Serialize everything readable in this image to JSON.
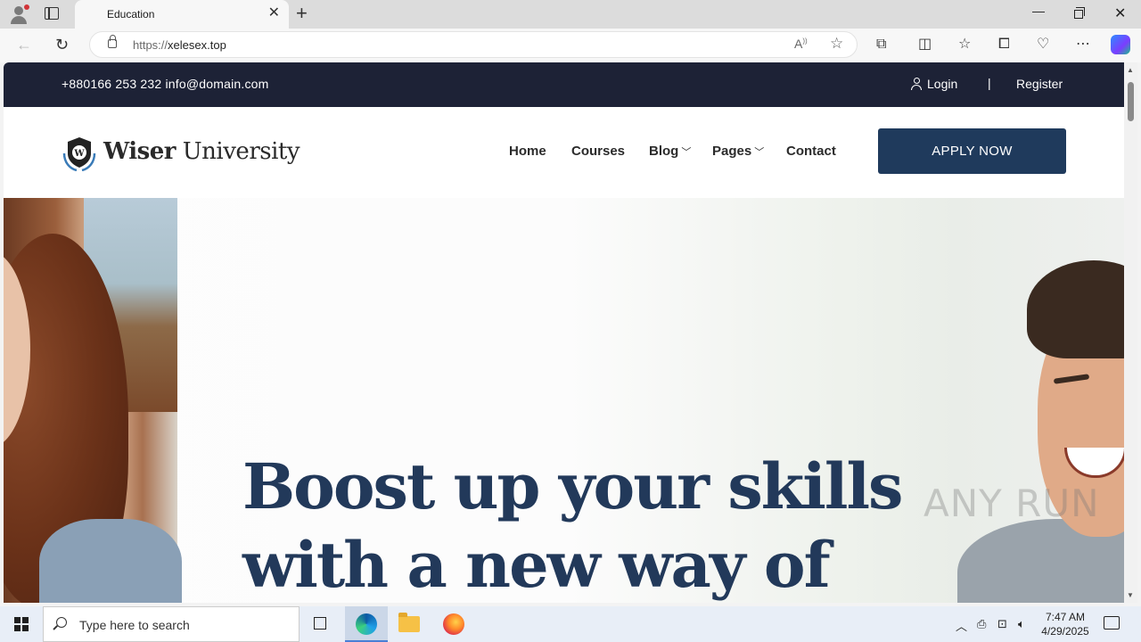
{
  "browser": {
    "tab_title": "Education",
    "url_prefix": "https://",
    "url_host": "xelesex.top"
  },
  "site": {
    "topbar": {
      "contact": "+880166 253 232 info@domain.com",
      "login": "Login",
      "divider": "|",
      "register": "Register"
    },
    "logo": {
      "bold": "Wiser",
      "rest": " University"
    },
    "nav": [
      {
        "label": "Home",
        "has_dropdown": false
      },
      {
        "label": "Courses",
        "has_dropdown": false
      },
      {
        "label": "Blog",
        "has_dropdown": true
      },
      {
        "label": "Pages",
        "has_dropdown": true
      },
      {
        "label": "Contact",
        "has_dropdown": false
      }
    ],
    "apply_button": "APPLY NOW",
    "hero": {
      "line1": "Boost up your skills",
      "line2": "with a new way of"
    },
    "watermark": "ANY RUN"
  },
  "taskbar": {
    "search_placeholder": "Type here to search",
    "time": "7:47 AM",
    "date": "4/29/2025"
  },
  "colors": {
    "topbar_bg": "#1d2236",
    "accent": "#1f3a5c",
    "hero_text": "#22395a"
  }
}
